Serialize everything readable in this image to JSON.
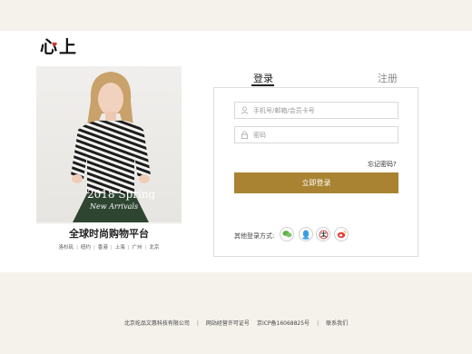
{
  "brand": {
    "logo_text": "心上"
  },
  "promo": {
    "headline_line1": "2018 Spring",
    "headline_line2": "New Arrivals",
    "title": "全球时尚购物平台",
    "cities": [
      "洛杉矶",
      "纽约",
      "香港",
      "上海",
      "广州",
      "北京"
    ]
  },
  "tabs": {
    "login": "登录",
    "register": "注册"
  },
  "form": {
    "account_placeholder": "手机号/邮箱/会员卡号",
    "password_placeholder": "密码",
    "forgot_password": "忘记密码?",
    "login_button": "立即登录",
    "other_login_label": "其他登录方式:"
  },
  "social_icons": [
    "wechat-icon",
    "qq-icon",
    "alipay-icon",
    "weibo-icon"
  ],
  "footer": {
    "company": "北京屹品文惠科技有限公司",
    "license": "网站经营许可证号",
    "icp": "京ICP备16068825号",
    "contact": "联系我们"
  },
  "colors": {
    "accent": "#a98331",
    "logo_heart": "#c0392b",
    "page_bg": "#f5f2ec"
  }
}
